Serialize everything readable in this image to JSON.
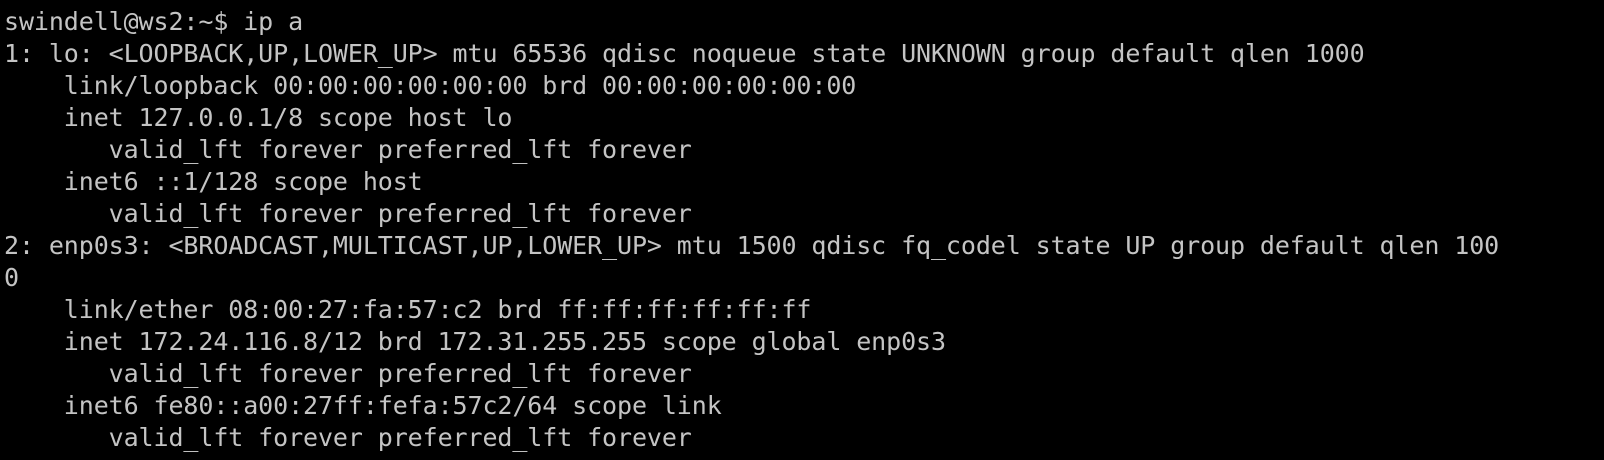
{
  "terminal": {
    "foreground": "#c4c4c4",
    "background": "#000000",
    "lines": [
      "swindell@ws2:~$ ip a",
      "1: lo: <LOOPBACK,UP,LOWER_UP> mtu 65536 qdisc noqueue state UNKNOWN group default qlen 1000",
      "    link/loopback 00:00:00:00:00:00 brd 00:00:00:00:00:00",
      "    inet 127.0.0.1/8 scope host lo",
      "       valid_lft forever preferred_lft forever",
      "    inet6 ::1/128 scope host",
      "       valid_lft forever preferred_lft forever",
      "2: enp0s3: <BROADCAST,MULTICAST,UP,LOWER_UP> mtu 1500 qdisc fq_codel state UP group default qlen 100",
      "0",
      "    link/ether 08:00:27:fa:57:c2 brd ff:ff:ff:ff:ff:ff",
      "    inet 172.24.116.8/12 brd 172.31.255.255 scope global enp0s3",
      "       valid_lft forever preferred_lft forever",
      "    inet6 fe80::a00:27ff:fefa:57c2/64 scope link",
      "       valid_lft forever preferred_lft forever"
    ]
  }
}
